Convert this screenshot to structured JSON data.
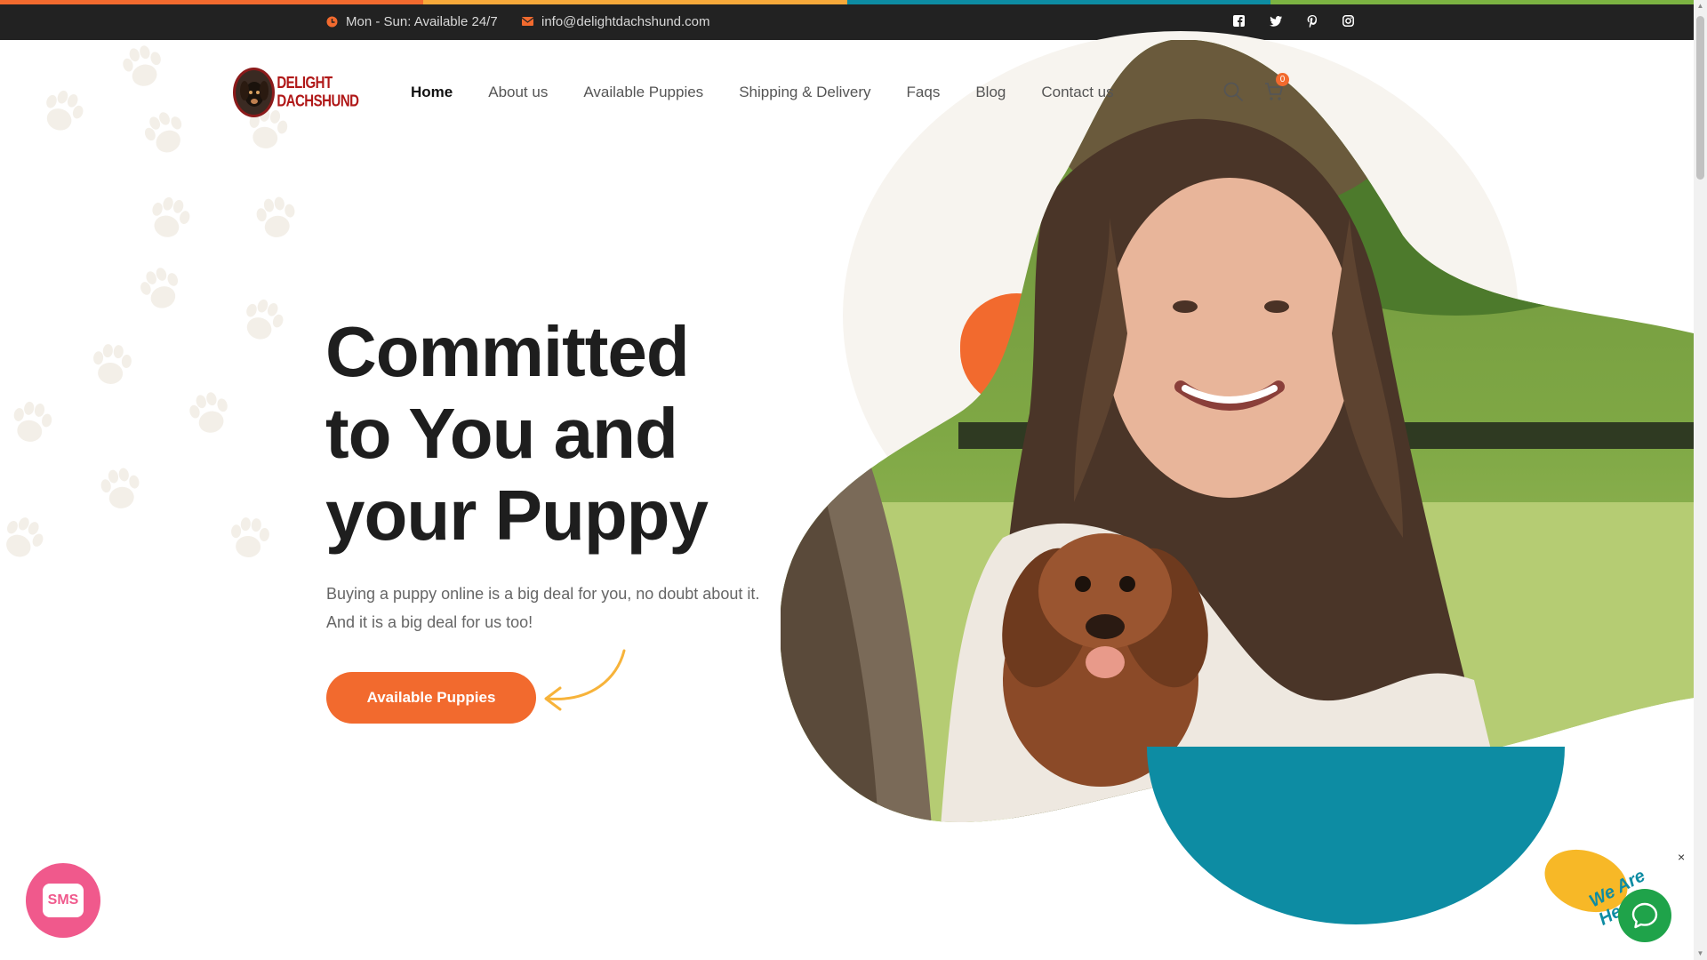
{
  "colors": {
    "accent_orange": "#f26a2e",
    "teal": "#0d8ca3",
    "topbar": "#222222",
    "sms_pink": "#f0598c",
    "chat_green": "#1fa34a",
    "chat_yellow": "#f7b827",
    "strip": [
      "#f26a2e",
      "#f7a93a",
      "#0d8ca3",
      "#7cb342"
    ]
  },
  "topbar": {
    "hours": "Mon - Sun: Available 24/7",
    "email": "info@delightdachshund.com",
    "social_icons": [
      "facebook-icon",
      "twitter-icon",
      "pinterest-icon",
      "instagram-icon"
    ]
  },
  "header": {
    "logo_text": "DELIGHT DACHSHUND",
    "nav": [
      {
        "label": "Home",
        "active": true
      },
      {
        "label": "About us"
      },
      {
        "label": "Available Puppies"
      },
      {
        "label": "Shipping & Delivery"
      },
      {
        "label": "Faqs"
      },
      {
        "label": "Blog"
      },
      {
        "label": "Contact us"
      }
    ],
    "cart_count": "0"
  },
  "hero": {
    "title_lines": [
      "Committed",
      "to You and",
      "your Puppy"
    ],
    "subtitle_line1": "Buying a puppy online is a big deal for you, no doubt about it.",
    "subtitle_line2": "And it is a big deal for us too!",
    "cta_label": "Available Puppies"
  },
  "widgets": {
    "sms_label": "SMS",
    "chat_tagline": "We Are Here!",
    "chat_close": "×"
  }
}
